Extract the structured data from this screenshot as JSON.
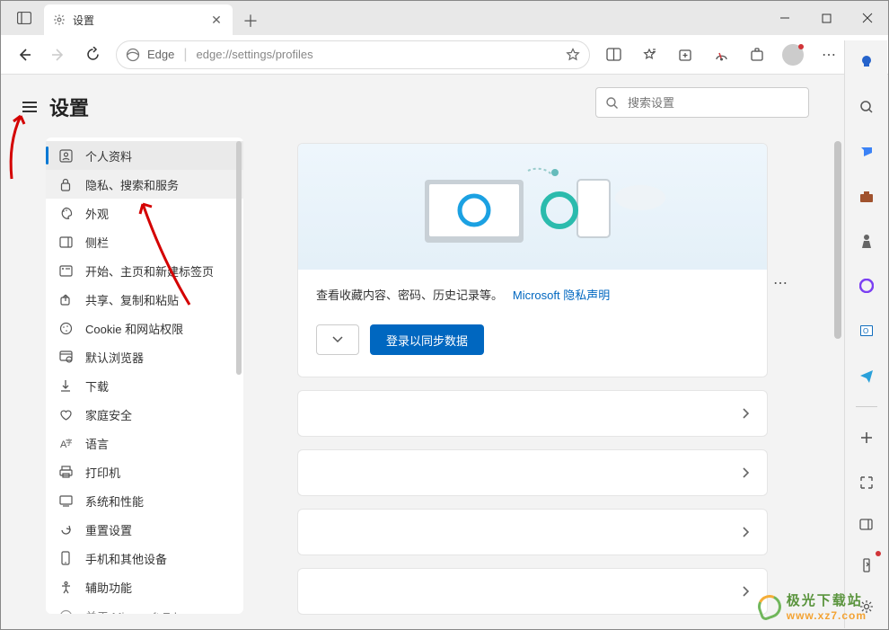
{
  "tab": {
    "title": "设置"
  },
  "address": {
    "brand": "Edge",
    "url": "edge://settings/profiles"
  },
  "settings": {
    "heading": "设置",
    "nav": [
      {
        "label": "个人资料",
        "icon": "profile"
      },
      {
        "label": "隐私、搜索和服务",
        "icon": "lock"
      },
      {
        "label": "外观",
        "icon": "palette"
      },
      {
        "label": "侧栏",
        "icon": "sidebar"
      },
      {
        "label": "开始、主页和新建标签页",
        "icon": "start"
      },
      {
        "label": "共享、复制和粘贴",
        "icon": "share"
      },
      {
        "label": "Cookie 和网站权限",
        "icon": "cookie"
      },
      {
        "label": "默认浏览器",
        "icon": "browser"
      },
      {
        "label": "下载",
        "icon": "download"
      },
      {
        "label": "家庭安全",
        "icon": "family"
      },
      {
        "label": "语言",
        "icon": "language"
      },
      {
        "label": "打印机",
        "icon": "printer"
      },
      {
        "label": "系统和性能",
        "icon": "system"
      },
      {
        "label": "重置设置",
        "icon": "reset"
      },
      {
        "label": "手机和其他设备",
        "icon": "phone"
      },
      {
        "label": "辅助功能",
        "icon": "accessibility"
      },
      {
        "label": "关于 Microsoft Edge",
        "icon": "edge"
      }
    ]
  },
  "search": {
    "placeholder": "搜索设置"
  },
  "hero": {
    "text_prefix": "查看收藏内容、密码、历史记录等。",
    "link": "Microsoft 隐私声明",
    "button": "登录以同步数据"
  },
  "watermark": {
    "cn": "极光下载站",
    "url": "www.xz7.com"
  }
}
